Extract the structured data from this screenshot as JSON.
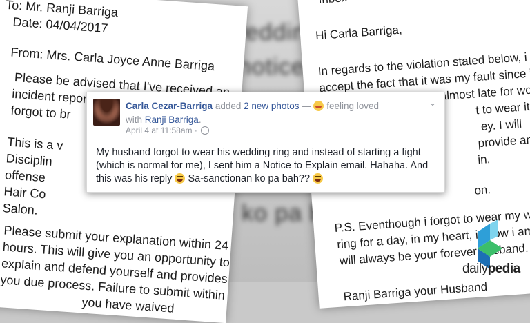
{
  "left_letter": {
    "lines": [
      "To: Mr. Ranji Barriga",
      "Date: 04/04/2017",
      "From: Mrs. Carla Joyce Anne Barriga",
      "Please be advised that I've received an",
      "incident report that on April 3, 2017 you",
      "forgot to br",
      "This is a v",
      "Disciplin",
      "offense",
      "Hair Co",
      "Salon.",
      "Please submit your explanation within 24",
      "hours. This will give you an opportunity to",
      "explain and defend yourself and provides",
      "you due process. Failure to submit within the",
      "you have waived"
    ]
  },
  "right_letter": {
    "inbox_label": "Inbox",
    "lines": [
      "Hi Carla Barriga,",
      "In regards to the violation stated below, i do",
      "accept the fact that it was my fault since i",
      "hurry and i was almost late for work",
      "t to wear it",
      "ey. I will",
      "provide and",
      "in.",
      "on.",
      "P.S. Eventhough i forgot to wear my wedding",
      "ring for a day, in my heart, i know i am and",
      "will always be your forever husband.",
      "Ranji Barriga your Husband"
    ]
  },
  "post": {
    "author": "Carla Cezar-Barriga",
    "action_text": "added",
    "photos_link": "2 new photos",
    "dash": "—",
    "feeling_text": "feeling loved",
    "with_text": "with",
    "tagged": "Ranji Barriga",
    "period": ".",
    "timestamp": "April 4 at 11:58am",
    "dot": "·",
    "body_part1": "My husband forgot to wear his wedding ring and instead of starting a fight (which is normal for me), I sent him a Notice to Explain email. Hahaha. And this was his reply",
    "body_part2": "Sa-sanctionan ko pa bah??",
    "chevron": "⌄"
  },
  "blurred_bg": {
    "texts": [
      "wedding ri",
      "notice t",
      "ko pa bah"
    ]
  },
  "logo": {
    "prefix": "daily",
    "suffix": "pedia",
    "colors": [
      "#2e9fd8",
      "#3cbf6a",
      "#1c6fb5"
    ]
  }
}
